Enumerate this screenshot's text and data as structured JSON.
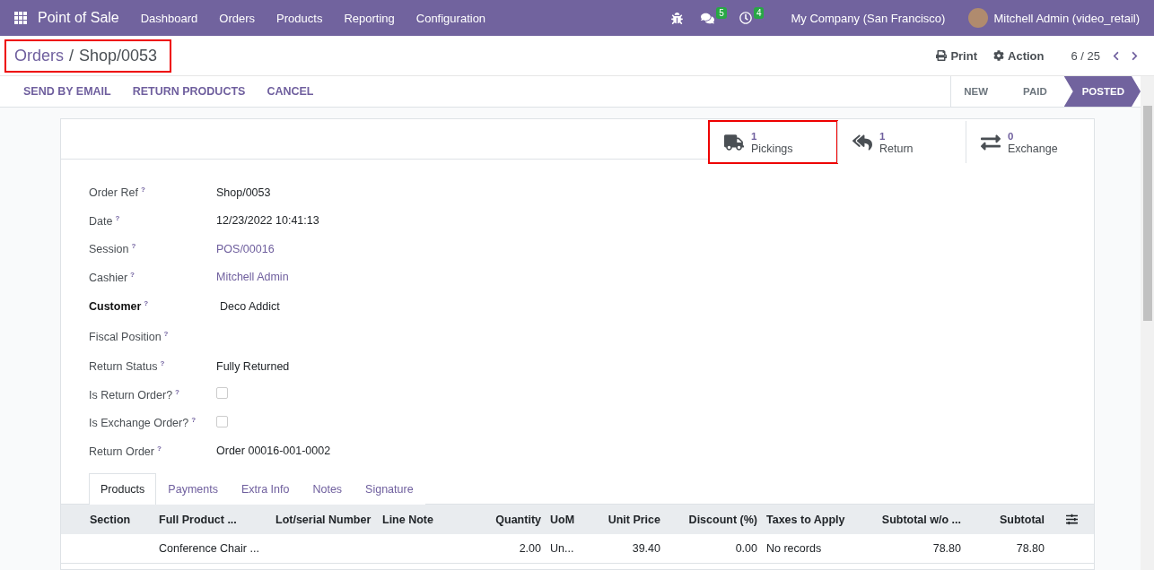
{
  "navbar": {
    "app_name": "Point of Sale",
    "menu": [
      "Dashboard",
      "Orders",
      "Products",
      "Reporting",
      "Configuration"
    ],
    "messages_badge": "5",
    "activities_badge": "4",
    "company": "My Company (San Francisco)",
    "user": "Mitchell Admin (video_retail)"
  },
  "breadcrumb": {
    "parent": "Orders",
    "separator": "/",
    "current": "Shop/0053",
    "highlighted": true
  },
  "toolbar": {
    "print": "Print",
    "action": "Action",
    "pager": "6 / 25"
  },
  "actions": [
    "SEND BY EMAIL",
    "RETURN PRODUCTS",
    "CANCEL"
  ],
  "statusbar": [
    {
      "label": "NEW",
      "selected": false
    },
    {
      "label": "PAID",
      "selected": false
    },
    {
      "label": "POSTED",
      "selected": true
    }
  ],
  "smart_buttons": [
    {
      "kind": "truck",
      "count": "1",
      "label": "Pickings",
      "highlighted": true
    },
    {
      "kind": "return",
      "count": "1",
      "label": "Return",
      "highlighted": false
    },
    {
      "kind": "exchange",
      "count": "0",
      "label": "Exchange",
      "highlighted": false
    }
  ],
  "fields": [
    {
      "kind": "text",
      "label": "Order Ref",
      "value": "Shop/0053",
      "required": false
    },
    {
      "kind": "text",
      "label": "Date",
      "value": "12/23/2022 10:41:13",
      "required": false
    },
    {
      "kind": "link",
      "label": "Session",
      "value": "POS/00016",
      "required": false
    },
    {
      "kind": "link",
      "label": "Cashier",
      "value": "Mitchell Admin",
      "required": false
    },
    {
      "kind": "text",
      "label": "Customer",
      "value": "Deco Addict",
      "required": true
    },
    {
      "kind": "empty",
      "label": "Fiscal Position",
      "required": false
    },
    {
      "kind": "text",
      "label": "Return Status",
      "value": "Fully Returned",
      "required": false
    },
    {
      "kind": "checkbox",
      "label": "Is Return Order?",
      "checked": false,
      "required": false
    },
    {
      "kind": "checkbox",
      "label": "Is Exchange Order?",
      "checked": false,
      "required": false
    },
    {
      "kind": "text",
      "label": "Return Order",
      "value": "Order 00016-001-0002",
      "required": false
    }
  ],
  "help_mark": "?",
  "tabs": [
    {
      "label": "Products",
      "selected": true
    },
    {
      "label": "Payments",
      "selected": false
    },
    {
      "label": "Extra Info",
      "selected": false
    },
    {
      "label": "Notes",
      "selected": false
    },
    {
      "label": "Signature",
      "selected": false
    }
  ],
  "table": {
    "columns": [
      "Section",
      "Full Product ...",
      "Lot/serial Number",
      "Line Note",
      "Quantity",
      "UoM",
      "Unit Price",
      "Discount (%)",
      "Taxes to Apply",
      "Subtotal w/o ...",
      "Subtotal"
    ],
    "rows": [
      [
        "",
        "Conference Chair ...",
        "",
        "",
        "2.00",
        "Un...",
        "39.40",
        "0.00",
        "No records",
        "78.80",
        "78.80"
      ]
    ]
  }
}
